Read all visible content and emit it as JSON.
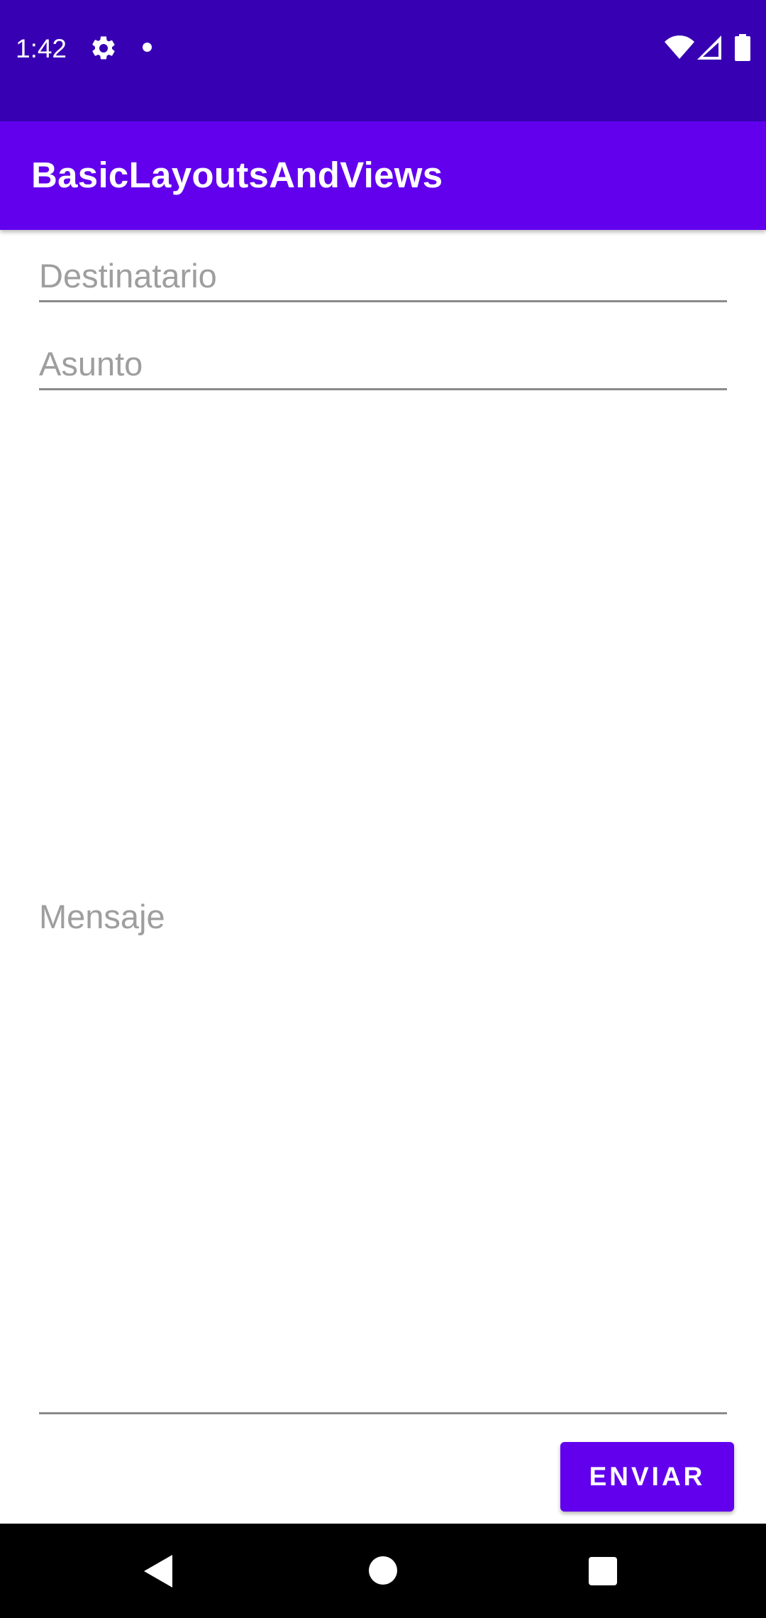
{
  "status_bar": {
    "time": "1:42",
    "icons": [
      "gear-icon",
      "notification-dot-icon",
      "wifi-icon",
      "signal-icon",
      "battery-icon"
    ]
  },
  "app_bar": {
    "title": "BasicLayoutsAndViews"
  },
  "form": {
    "recipient": {
      "value": "",
      "placeholder": "Destinatario"
    },
    "subject": {
      "value": "",
      "placeholder": "Asunto"
    },
    "message": {
      "value": "",
      "placeholder": "Mensaje"
    },
    "send_label": "ENVIAR"
  },
  "nav_bar": {
    "icons": [
      "back-icon",
      "home-icon",
      "recents-icon"
    ]
  },
  "colors": {
    "status_bar": "#3700b3",
    "primary": "#6200ee",
    "hint_text": "#9e9e9e",
    "field_underline": "#8a8a8a"
  }
}
